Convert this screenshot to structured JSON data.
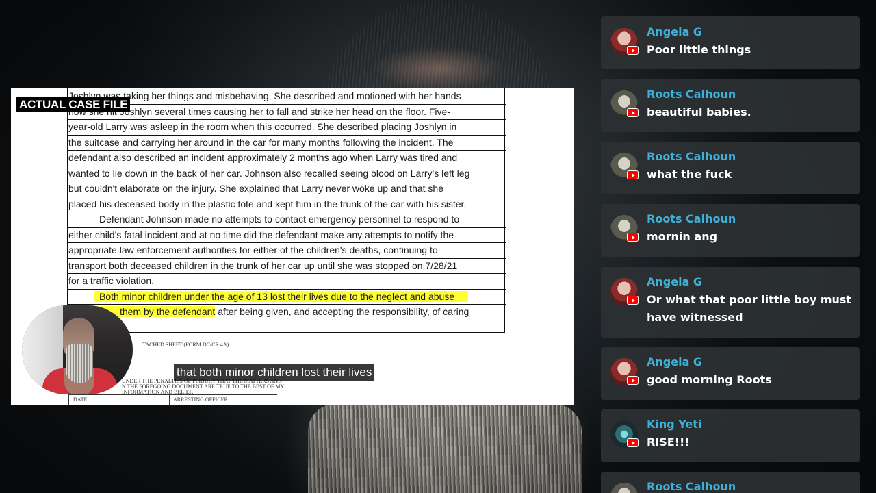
{
  "document": {
    "badge": "ACTUAL CASE FILE",
    "lines": [
      "Joshlyn was taking her things and misbehaving. She described and motioned with her hands",
      "how she hit Joshlyn several times causing her to fall and strike her head on the floor. Five-",
      "year-old Larry was asleep in the room when this occurred. She described placing Joshlyn in",
      "the suitcase and carrying her around in the car for many months following the incident. The",
      "defendant also described an incident approximately 2 months ago when Larry was tired and",
      "wanted to lie down in the back of her car. Johnson also recalled seeing blood on Larry's left leg",
      "but couldn't elaborate on the injury. She explained that Larry never woke up and that she",
      "placed his deceased body in the plastic tote and kept him in the trunk of the car with his sister.",
      "Defendant Johnson made no attempts to contact emergency personnel to respond to",
      "either child's fatal incident and at no time did the defendant make any attempts to notify the",
      "appropriate law enforcement authorities for either of the children's deaths, continuing to",
      "transport both deceased children in the trunk of her car up until she was stopped on 7/28/21",
      "for a traffic violation.",
      "Both minor children under the age of 13 lost their lives due to the neglect and abuse"
    ],
    "last_line_highlight": "them by the defendant",
    "last_line_rest": " after being given, and accepting the responsibility, of caring",
    "attached_sheet": "TACHED SHEET (FORM DC/CR 4A)",
    "perjury_lines": [
      "UNDER THE PENALTIES OF PERJURY THAT THE MATTERS AND",
      "N THE FOREGOING DOCUMENT ARE TRUE TO THE BEST OF MY",
      "INFORMATION AND BELIEF."
    ],
    "date_label": "DATE",
    "officer_label": "ARRESTING OFFICER"
  },
  "caption": "that both minor children lost their lives",
  "chat": {
    "messages": [
      {
        "author": "Angela G",
        "avatar": "angela-avatar",
        "text": "Poor little things"
      },
      {
        "author": "Roots Calhoun",
        "avatar": "roots-avatar",
        "text": "beautiful babies."
      },
      {
        "author": "Roots Calhoun",
        "avatar": "roots-avatar",
        "text": "what the fuck"
      },
      {
        "author": "Roots Calhoun",
        "avatar": "roots-avatar",
        "text": "mornin ang"
      },
      {
        "author": "Angela G",
        "avatar": "angela-avatar",
        "text": "Or what that poor little boy must have witnessed"
      },
      {
        "author": "Angela G",
        "avatar": "angela-avatar",
        "text": "good morning Roots"
      },
      {
        "author": "King Yeti",
        "avatar": "yeti-avatar",
        "text": "RISE!!!"
      },
      {
        "author": "Roots Calhoun",
        "avatar": "roots-avatar",
        "text": ""
      }
    ],
    "platform_icon": "youtube-icon",
    "author_color": "#3fb0d8",
    "highlight_color": "#ffff33"
  }
}
